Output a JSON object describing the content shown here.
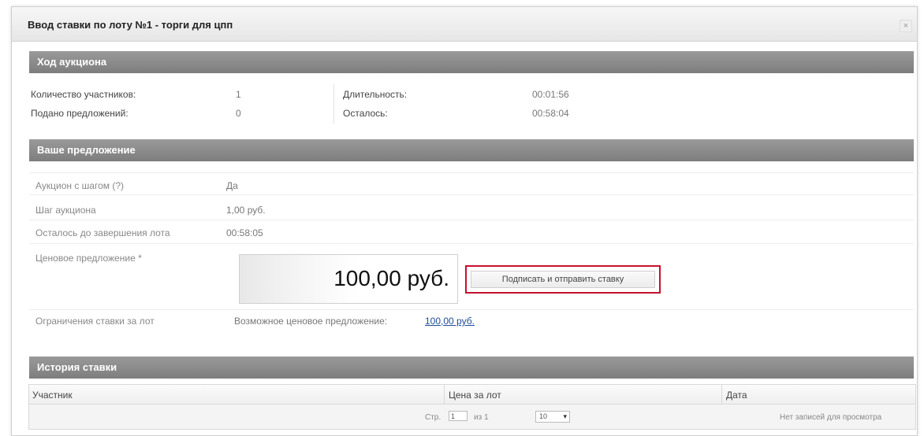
{
  "dialog": {
    "title": "Ввод ставки по лоту №1 - торги для цпп",
    "close_icon": "close-icon",
    "close_glyph": "×"
  },
  "auction_progress": {
    "header": "Ход аукциона",
    "participants_label": "Количество участников:",
    "participants_value": "1",
    "offers_label": "Подано предложений:",
    "offers_value": "0",
    "duration_label": "Длительность:",
    "duration_value": "00:01:56",
    "remaining_label": "Осталось:",
    "remaining_value": "00:58:04"
  },
  "your_offer": {
    "header": "Ваше предложение",
    "auction_step_mode_label": "Аукцион с шагом (?)",
    "auction_step_mode_value": "Да",
    "step_label": "Шаг аукциона",
    "step_value": "1,00 руб.",
    "time_left_label": "Осталось до завершения лота",
    "time_left_value": "00:58:05",
    "price_label": "Ценовое предложение *",
    "price_value": "100,00 руб.",
    "sign_button": "Подписать и отправить ставку",
    "limit_label": "Ограничения ставки за лот",
    "limit_text": "Возможное ценовое предложение:",
    "limit_link": "100,00 руб."
  },
  "history": {
    "header": "История ставки",
    "columns": [
      "Участник",
      "Цена за лот",
      "Дата"
    ],
    "pager": {
      "page_label": "Стр.",
      "page_value": "1",
      "of_label": "из 1",
      "per_page": "10",
      "empty_text": "Нет записей для просмотра"
    }
  },
  "colors": {
    "section_header": "#8a8a8a",
    "highlight_border": "#c8102e",
    "link": "#1f4d99"
  }
}
